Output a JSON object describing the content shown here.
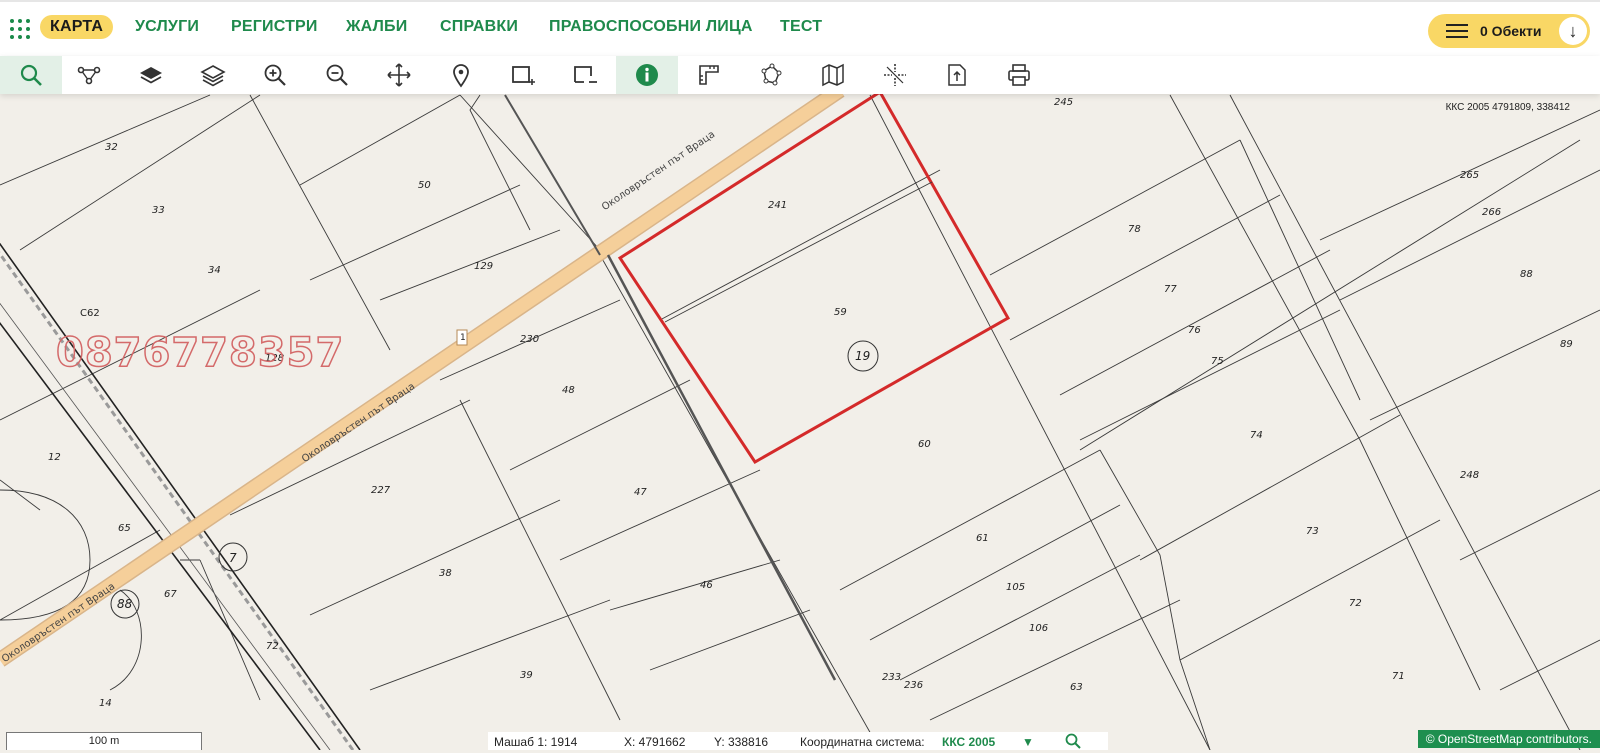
{
  "nav": {
    "items": [
      "КАРТА",
      "УСЛУГИ",
      "РЕГИСТРИ",
      "ЖАЛБИ",
      "СПРАВКИ",
      "ПРАВОСПОСОБНИ ЛИЦА",
      "ТЕСТ"
    ],
    "active": "КАРТА",
    "objects_label": "0 Обекти"
  },
  "toolbar": {
    "tools": [
      "search-icon",
      "route-icon",
      "layers-icon",
      "layers-outline-icon",
      "zoom-in-icon",
      "zoom-out-icon",
      "pan-icon",
      "location-pin-icon",
      "select-add-icon",
      "select-remove-icon",
      "info-icon",
      "measure-icon",
      "polygon-icon",
      "map-icon",
      "crosshair-icon",
      "export-icon",
      "print-icon"
    ],
    "active_tool": "info-icon"
  },
  "map": {
    "coordinate_readout": "ККС 2005 4791809, 338412",
    "watermark_phone": "0876778357",
    "road_name": "Околовръстен път Враца",
    "road_number": "1",
    "parcel_numbers": [
      "32",
      "33",
      "34",
      "50",
      "129",
      "128",
      "12",
      "65",
      "67",
      "72",
      "14",
      "227",
      "38",
      "39",
      "230",
      "48",
      "47",
      "46",
      "241",
      "59",
      "60",
      "61",
      "105",
      "106",
      "63",
      "233",
      "236",
      "245",
      "78",
      "77",
      "76",
      "75",
      "74",
      "73",
      "72",
      "71",
      "265",
      "266",
      "88",
      "89",
      "248",
      "С62"
    ],
    "circled_numbers": [
      "19",
      "7",
      "88"
    ],
    "highlight_color": "#d42a2a"
  },
  "status": {
    "scale_bar": "100 m",
    "scale": "Машаб 1:  1914",
    "x": "X:  4791662",
    "y": "Y:  338816",
    "coord_system_label": "Координатна система:",
    "coord_system_value": "ККС 2005",
    "attribution": "©  OpenStreetMap  contributors."
  },
  "colors": {
    "accent": "#1f8a4c",
    "yellow": "#f9d765",
    "map_bg": "#f2efe9",
    "road": "#f5cf9a"
  }
}
